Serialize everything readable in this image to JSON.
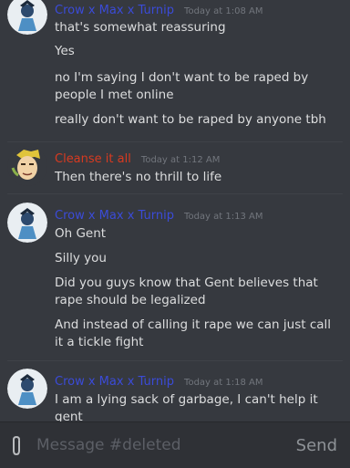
{
  "colors": {
    "background": "#36393f",
    "crow_username": "#3b4bd8",
    "cleanse_username": "#d83a20",
    "text": "#dcddde",
    "timestamp": "#72767d"
  },
  "messages": [
    {
      "username": "Crow x Max x Turnip",
      "timestamp": "Today at 1:08 AM",
      "lines": [
        "that's somewhat reassuring",
        "Yes",
        "no I'm saying I don't want to be raped by people I met online",
        "really don't want to be raped by anyone tbh"
      ]
    },
    {
      "username": "Cleanse it all",
      "timestamp": "Today at 1:12 AM",
      "lines": [
        "Then there's no thrill to life"
      ]
    },
    {
      "username": "Crow x Max x Turnip",
      "timestamp": "Today at 1:13 AM",
      "lines": [
        "Oh Gent",
        "Silly you",
        "Did you guys know that Gent believes that rape should be legalized",
        "And instead of calling it rape we can just call it a tickle fight"
      ]
    },
    {
      "username": "Crow x Max x Turnip",
      "timestamp": "Today at 1:18 AM",
      "lines": [
        "I am a lying sack of garbage, I can't help it gent"
      ]
    }
  ],
  "composer": {
    "placeholder": "Message #deleted",
    "send_label": "Send",
    "attach_icon": "paperclip-icon"
  }
}
